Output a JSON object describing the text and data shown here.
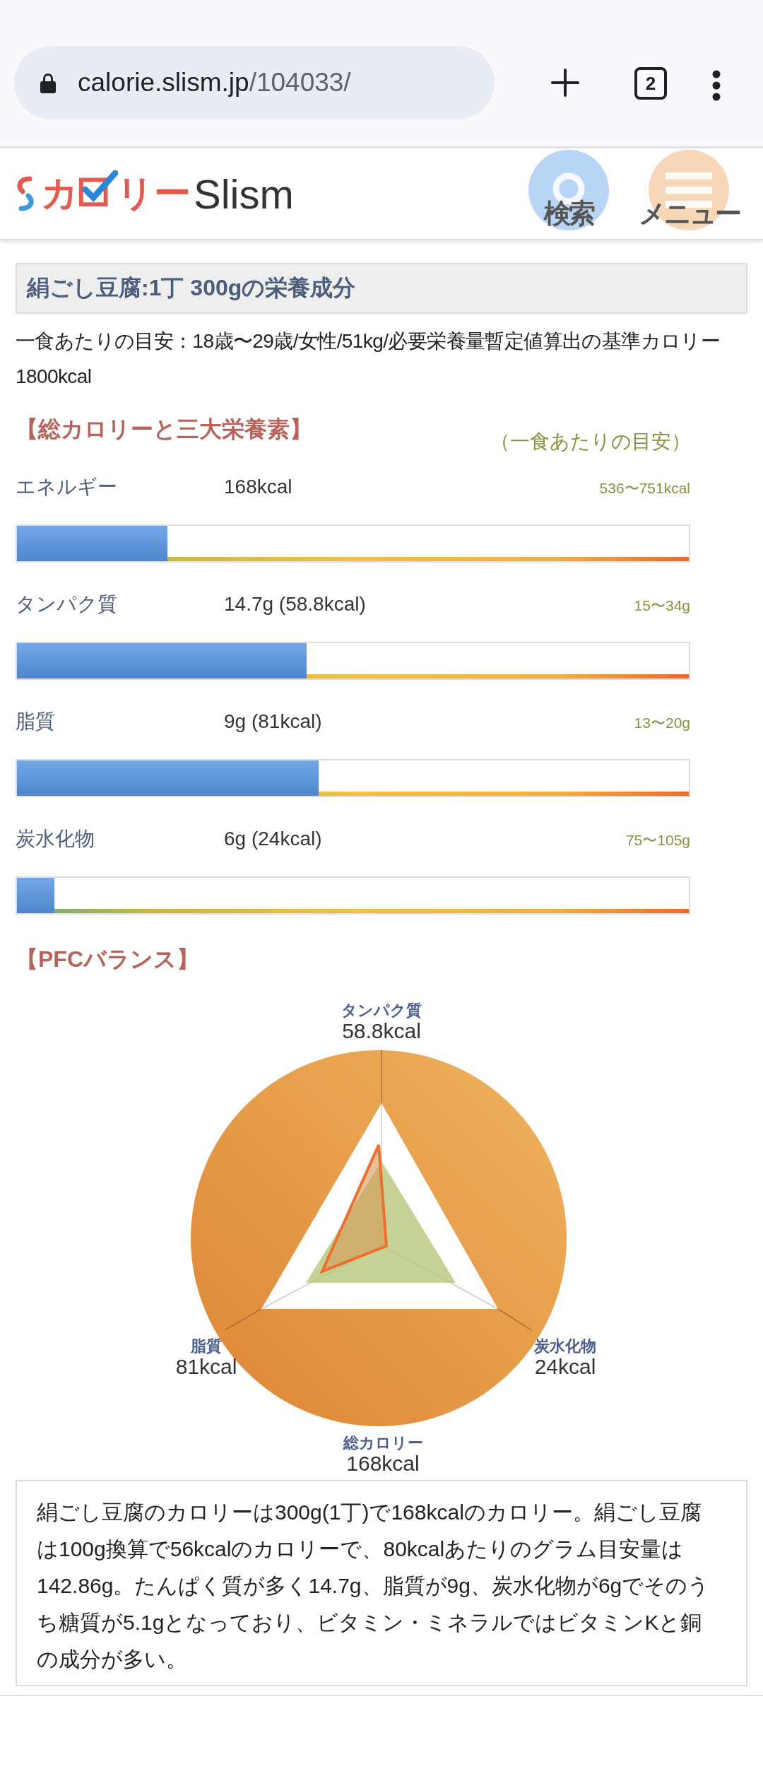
{
  "browser": {
    "url_host": "calorie.slism.jp",
    "url_path": "/104033/",
    "tab_count": "2"
  },
  "site_header": {
    "logo": {
      "part_1": "カ",
      "part_2": "リー",
      "part_3": "Slism"
    },
    "search_label": "検索",
    "menu_label": "メニュー"
  },
  "title": "絹ごし豆腐:1丁 300gの栄養成分",
  "reference": "一食あたりの目安：18歳〜29歳/女性/51kg/必要栄養量暫定値算出の基準カロリー1800kcal",
  "section_heading": "【総カロリーと三大栄養素】",
  "guide_label": "（一食あたりの目安）",
  "nutrients": [
    {
      "name": "エネルギー",
      "amount": "168kcal",
      "range": "536〜751kcal",
      "level": 0.224
    },
    {
      "name": "タンパク質",
      "amount": "14.7g (58.8kcal)",
      "range": "15〜34g",
      "level": 0.431
    },
    {
      "name": "脂質",
      "amount": "9g (81kcal)",
      "range": "13〜20g",
      "level": 0.449
    },
    {
      "name": "炭水化物",
      "amount": "6g (24kcal)",
      "range": "75〜105g",
      "level": 0.056
    }
  ],
  "pfc": {
    "heading": "【PFCバランス】",
    "labels": [
      {
        "name": "タンパク質",
        "value": "58.8kcal"
      },
      {
        "name": "脂質",
        "value": "81kcal"
      },
      {
        "name": "炭水化物",
        "value": "24kcal"
      },
      {
        "name": "総カロリー",
        "value": "168kcal"
      }
    ]
  },
  "summary": "絹ごし豆腐のカロリーは300g(1丁)で168kcalのカロリー。絹ごし豆腐は100g換算で56kcalのカロリーで、80kcalあたりのグラム目安量は142.86g。たんぱく質が多く14.7g、脂質が9g、炭水化物が6gでそのうち糖質が5.1gとなっており、ビタミン・ミネラルではビタミンKと銅の成分が多い。"
}
